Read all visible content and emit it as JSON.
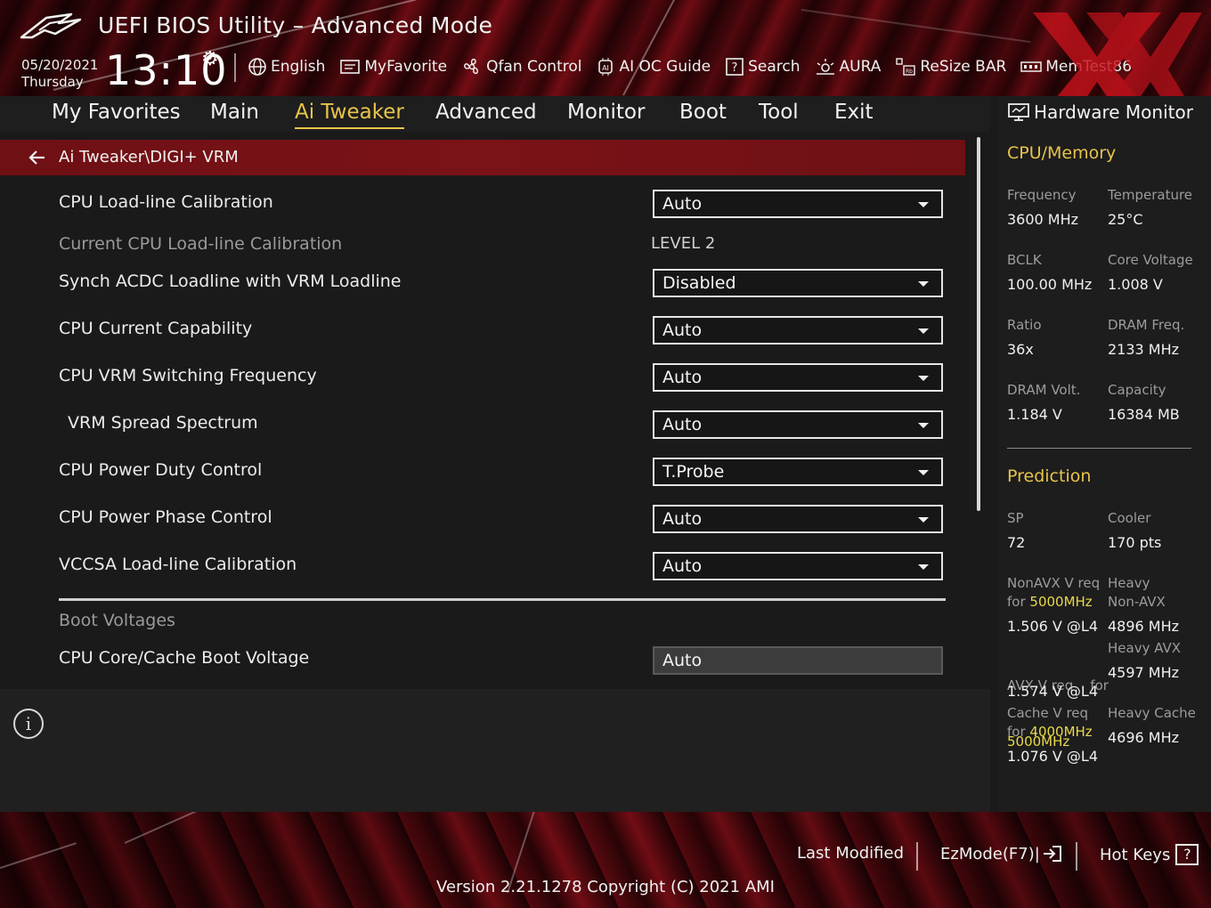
{
  "header": {
    "title": "UEFI BIOS Utility – Advanced Mode",
    "date": "05/20/2021",
    "day": "Thursday",
    "time": "13:10",
    "tools": [
      {
        "label": "English",
        "icon": "globe-icon"
      },
      {
        "label": "MyFavorite",
        "icon": "favorite-list-icon"
      },
      {
        "label": "Qfan Control",
        "icon": "fan-icon"
      },
      {
        "label": "AI OC Guide",
        "icon": "ai-chip-icon"
      },
      {
        "label": "Search",
        "icon": "search-help-icon"
      },
      {
        "label": "AURA",
        "icon": "aura-light-icon"
      },
      {
        "label": "ReSize BAR",
        "icon": "resize-bar-icon"
      },
      {
        "label": "MemTest86",
        "icon": "memtest-icon"
      }
    ]
  },
  "nav": {
    "tabs": [
      "My Favorites",
      "Main",
      "Ai Tweaker",
      "Advanced",
      "Monitor",
      "Boot",
      "Tool",
      "Exit"
    ],
    "active": "Ai Tweaker"
  },
  "main": {
    "breadcrumb": "Ai Tweaker\\DIGI+ VRM",
    "settings": [
      {
        "label": "CPU Load-line Calibration",
        "value": "Auto",
        "type": "dropdown"
      },
      {
        "label": "Current CPU Load-line Calibration",
        "value": "LEVEL 2",
        "type": "readonly"
      },
      {
        "label": "Synch ACDC Loadline with VRM Loadline",
        "value": "Disabled",
        "type": "dropdown"
      },
      {
        "label": "CPU Current Capability",
        "value": "Auto",
        "type": "dropdown"
      },
      {
        "label": "CPU VRM Switching Frequency",
        "value": "Auto",
        "type": "dropdown"
      },
      {
        "label": "VRM Spread Spectrum",
        "value": "Auto",
        "type": "dropdown"
      },
      {
        "label": "CPU Power Duty Control",
        "value": "T.Probe",
        "type": "dropdown"
      },
      {
        "label": "CPU Power Phase Control",
        "value": "Auto",
        "type": "dropdown"
      },
      {
        "label": "VCCSA Load-line Calibration",
        "value": "Auto",
        "type": "dropdown"
      }
    ],
    "section_heading": "Boot Voltages",
    "boot_voltage": {
      "label": "CPU Core/Cache Boot Voltage",
      "value": "Auto"
    }
  },
  "hw_monitor": {
    "title": "Hardware Monitor",
    "cpu_memory_heading": "CPU/Memory",
    "stats": {
      "frequency": {
        "label": "Frequency",
        "value": "3600 MHz"
      },
      "temperature": {
        "label": "Temperature",
        "value": "25°C"
      },
      "bclk": {
        "label": "BCLK",
        "value": "100.00 MHz"
      },
      "core_voltage": {
        "label": "Core Voltage",
        "value": "1.008 V"
      },
      "ratio": {
        "label": "Ratio",
        "value": "36x"
      },
      "dram_freq": {
        "label": "DRAM Freq.",
        "value": "2133 MHz"
      },
      "dram_volt": {
        "label": "DRAM Volt.",
        "value": "1.184 V"
      },
      "capacity": {
        "label": "Capacity",
        "value": "16384 MB"
      }
    },
    "prediction_heading": "Prediction",
    "prediction": {
      "sp": {
        "label": "SP",
        "value": "72"
      },
      "cooler": {
        "label": "Cooler",
        "value": "170 pts"
      },
      "nonavx_req": {
        "label1": "NonAVX V req",
        "label2_prefix": "for ",
        "label2_freq": "5000MHz",
        "value": "1.506 V @L4"
      },
      "heavy_nonavx": {
        "label1": "Heavy",
        "label2": "Non-AVX",
        "value": "4896 MHz"
      },
      "avx_req": {
        "label1": "AVX V req    for",
        "label2_freq": "5000MHz",
        "value": "1.574 V @L4"
      },
      "heavy_avx": {
        "label1": "Heavy AVX",
        "value": "4597 MHz"
      },
      "cache_req": {
        "label1": "Cache V req",
        "label2_prefix": "for ",
        "label2_freq": "4000MHz",
        "value": "1.076 V @L4"
      },
      "heavy_cache": {
        "label1": "Heavy Cache",
        "value": "4696 MHz"
      }
    }
  },
  "footer": {
    "last_modified": "Last Modified",
    "ezmode": "EzMode(F7)|",
    "hot_keys": "Hot Keys",
    "hot_keys_glyph": "?",
    "version": "Version 2.21.1278 Copyright (C) 2021 AMI"
  },
  "colors": {
    "accent_yellow": "#e8c44a",
    "breadcrumb_red": "#7a1318",
    "panel_dark": "#1a1a1a"
  }
}
